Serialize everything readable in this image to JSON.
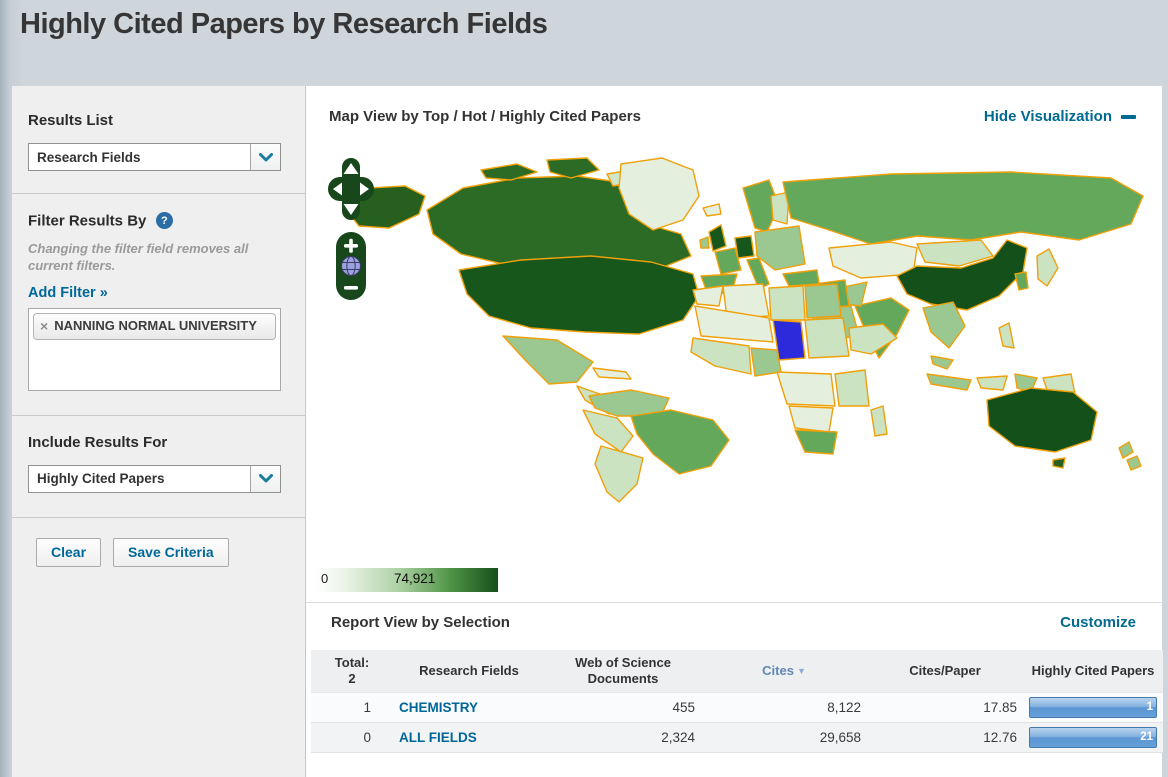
{
  "page": {
    "title": "Highly Cited Papers by Research Fields"
  },
  "sidebar": {
    "results_list": {
      "label": "Results List",
      "value": "Research Fields"
    },
    "filter": {
      "label": "Filter Results By",
      "help_icon": "?",
      "note": "Changing the filter field removes all current filters.",
      "add_filter_label": "Add Filter »",
      "tag": {
        "remove_icon": "×",
        "label": "NANNING NORMAL UNIVERSITY"
      }
    },
    "include_results": {
      "label": "Include Results For",
      "value": "Highly Cited Papers"
    },
    "buttons": {
      "clear": "Clear",
      "save": "Save Criteria"
    }
  },
  "map_section": {
    "title": "Map View by Top / Hot / Highly Cited Papers",
    "hide_link": "Hide Visualization",
    "controls": {
      "zoom_in": "+",
      "zoom_out": "−"
    },
    "legend": {
      "min": "0",
      "max": "74,921"
    }
  },
  "report": {
    "title": "Report View by Selection",
    "customize_link": "Customize",
    "table": {
      "total_label": "Total:",
      "total_value": "2",
      "columns": {
        "research_fields": "Research Fields",
        "documents": "Web of Science Documents",
        "cites": "Cites",
        "sort_icon": "▼",
        "cites_per_paper": "Cites/Paper",
        "highly_cited": "Highly Cited Papers"
      },
      "rows": [
        {
          "index": "1",
          "field": "CHEMISTRY",
          "documents": "455",
          "cites": "8,122",
          "cites_per_paper": "17.85",
          "highly_cited": "1"
        },
        {
          "index": "0",
          "field": "ALL FIELDS",
          "documents": "2,324",
          "cites": "29,658",
          "cites_per_paper": "12.76",
          "highly_cited": "21"
        }
      ]
    }
  },
  "colors": {
    "accent_teal": "#006a92",
    "map_border_orange": "#f0a009",
    "map_highlight_blue": "#2b2bdb",
    "legend_min_color": "#ffffff",
    "legend_max_color": "#16501c",
    "bar_blue": "#5b95d2"
  }
}
